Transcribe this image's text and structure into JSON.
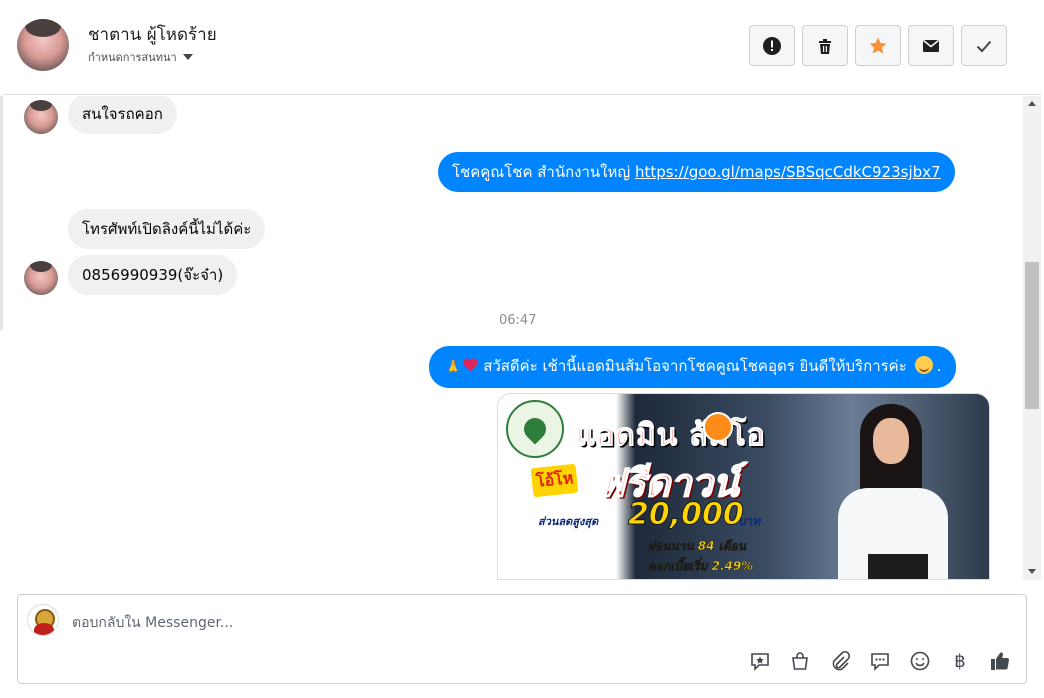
{
  "header": {
    "contact_name": "ชาตาน ผู้โหดร้าย",
    "subtitle": "กำหนดการสนทนา",
    "actions": [
      {
        "icon": "alert-icon"
      },
      {
        "icon": "trash-icon"
      },
      {
        "icon": "star-icon"
      },
      {
        "icon": "mail-icon"
      },
      {
        "icon": "check-icon"
      }
    ]
  },
  "messages": {
    "m1": "สนใจรถคอก",
    "m2_prefix": "โชคคูณโชค สำนักงานใหญ่ ",
    "m2_link": "https://goo.gl/maps/SBSqcCdkC923sjbx7",
    "m3": "โทรศัพท์เปิดลิงค์นี้ไม่ได้ค่ะ",
    "m4": "0856990939(จ๊ะจ๋า)",
    "timestamp": "06:47",
    "m5": "สวัสดีค่ะ เช้านี้แอดมินส้มโอจากโชคคูณโชคอุดร ยินดีให้บริการค่ะ",
    "m5_suffix": "."
  },
  "promo": {
    "title": "แอดมิน  ส้มโอ",
    "gift": "โอ้โห",
    "free": "ฟรีดาวน์",
    "discount_label": "ส่วนลดสูงสุด",
    "amount": "20,000",
    "baht": "บาท",
    "installment": "ผ่อนนาน 84 เดือน",
    "interest": "ดอกเบี้ยเริ่ม 2.49%"
  },
  "composer": {
    "placeholder": "ตอบกลับใน Messenger...",
    "tools": [
      "sticker-icon",
      "shop-icon",
      "attach-icon",
      "saved-reply-icon",
      "emoji-icon",
      "baht-icon",
      "like-icon"
    ],
    "baht_symbol": "฿"
  },
  "colors": {
    "accent": "#0084ff",
    "incoming_bubble": "#f0f0f0",
    "star": "#f7923b"
  }
}
